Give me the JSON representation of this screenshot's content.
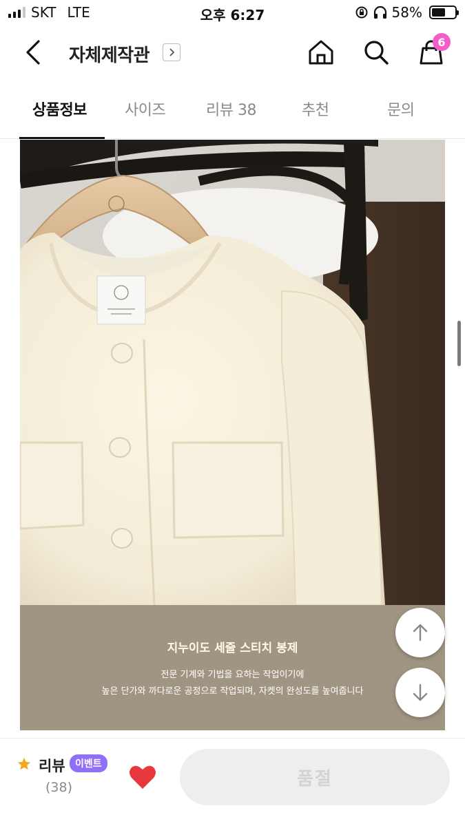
{
  "status_bar": {
    "carrier": "SKT",
    "network": "LTE",
    "time": "오후 6:27",
    "battery": "58%",
    "battery_level": 0.58
  },
  "header": {
    "shop_name": "자체제작관",
    "cart_count": "6",
    "badge_color": "#f25dc8"
  },
  "tabs": [
    {
      "label": "상품정보",
      "active": true
    },
    {
      "label": "사이즈"
    },
    {
      "label": "리뷰 38"
    },
    {
      "label": "추천"
    },
    {
      "label": "문의"
    }
  ],
  "banner": {
    "title": "지누이도 세줄 스티치 봉제",
    "desc_line1": "전문 기계와 기법을 요하는 작업이기에",
    "desc_line2": "높은 단가와 까다로운 공정으로 작업되며, 자켓의 완성도를 높여줍니다",
    "bg_color": "#a09583"
  },
  "bottom_bar": {
    "review_label": "리뷰",
    "event_badge": "이벤트",
    "review_count": "(38)",
    "buy_button": "품절",
    "event_color": "#8f6ff5",
    "heart_color": "#e8383d"
  },
  "icons": [
    "back-icon",
    "chevron-right-icon",
    "home-icon",
    "search-icon",
    "shopping-bag-icon",
    "arrow-up-icon",
    "arrow-down-icon",
    "star-icon",
    "heart-icon"
  ]
}
